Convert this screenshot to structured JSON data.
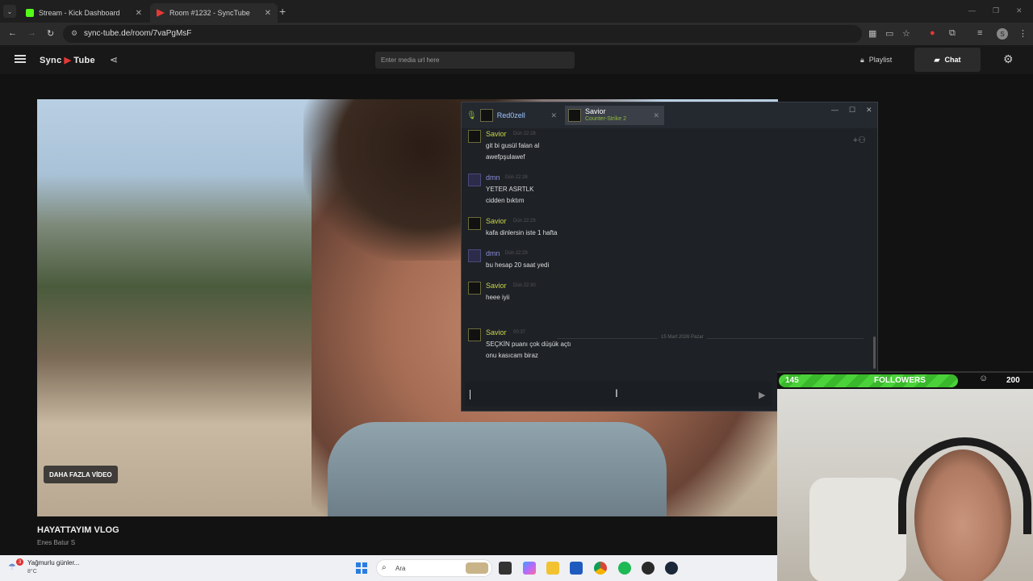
{
  "browser": {
    "tabs": [
      {
        "label": "Stream - Kick Dashboard",
        "icon": "kick-icon",
        "color": "#53fc18"
      },
      {
        "label": "Room #1232 - SyncTube",
        "icon": "synctube-icon",
        "color": "#e53935"
      }
    ],
    "new_tab": "+",
    "url": "sync-tube.de/room/7vaPgMsF"
  },
  "app": {
    "logo_left": "Sync",
    "logo_right": "Tube",
    "media_placeholder": "Enter media url here",
    "playlist_label": "Playlist",
    "chat_label": "Chat"
  },
  "video": {
    "more_videos": "DAHA FAZLA VİDEO",
    "title": "HAYATTAYIM VLOG",
    "author": "Enes Batur S"
  },
  "steam_chat": {
    "tabs": [
      {
        "name": "Red0zell",
        "subtitle": ""
      },
      {
        "name": "Savior",
        "subtitle": "Counter-Strike 2"
      }
    ],
    "messages": [
      {
        "user": "Savior",
        "time": "Dün 22:28",
        "lines": [
          "git bi gusül falan al",
          "awefpşulawef"
        ]
      },
      {
        "user": "dmn",
        "time": "Dün 22:28",
        "lines": [
          "YETER ASRTLK",
          "cidden bıktım"
        ]
      },
      {
        "user": "Savior",
        "time": "Dün 22:29",
        "lines": [
          "kafa dinlersin iste 1 hafta"
        ]
      },
      {
        "user": "dmn",
        "time": "Dün 22:29",
        "lines": [
          "bu hesap 20 saat yedi"
        ]
      },
      {
        "user": "Savior",
        "time": "Dün 22:30",
        "lines": [
          "heee iyii"
        ]
      },
      {
        "user": "Savior",
        "time": "00:37",
        "lines": [
          "SEÇKİN puanı çok düşük açtı",
          "onu kasıcam biraz"
        ]
      }
    ],
    "date_separator": "15 Mart 2026 Pazar"
  },
  "followers": {
    "current": "145",
    "label": "FOLLOWERS",
    "goal": "200",
    "progress": 0.725,
    "bar_color": "#4bd23a"
  },
  "taskbar": {
    "weather_badge": "3",
    "weather_text": "Yağmurlu günler...",
    "temperature": "8°C",
    "search_label": "Ara"
  }
}
